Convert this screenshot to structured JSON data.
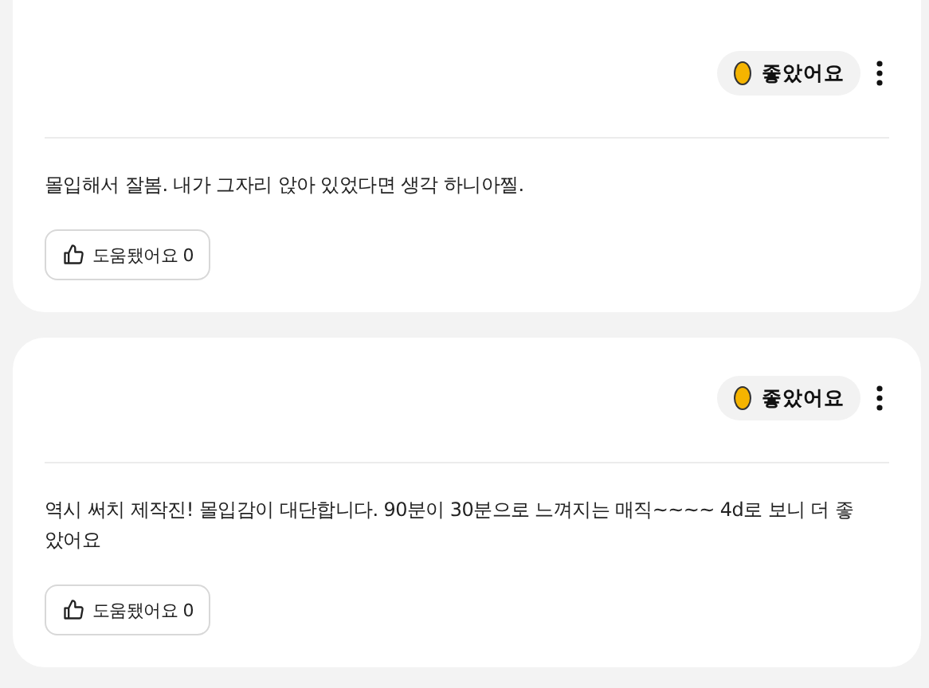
{
  "reviews": [
    {
      "rating": "좋았어요",
      "text": "몰입해서 잘봄. 내가 그자리 앉아 있었다면 생각 하니아찔.",
      "helpful": "도움됐어요 0"
    },
    {
      "rating": "좋았어요",
      "text": "역시 써치 제작진! 몰입감이 대단합니다. 90분이 30분으로 느껴지는 매직~~~~ 4d로 보니 더 좋았어요",
      "helpful": "도움됐어요 0"
    }
  ]
}
